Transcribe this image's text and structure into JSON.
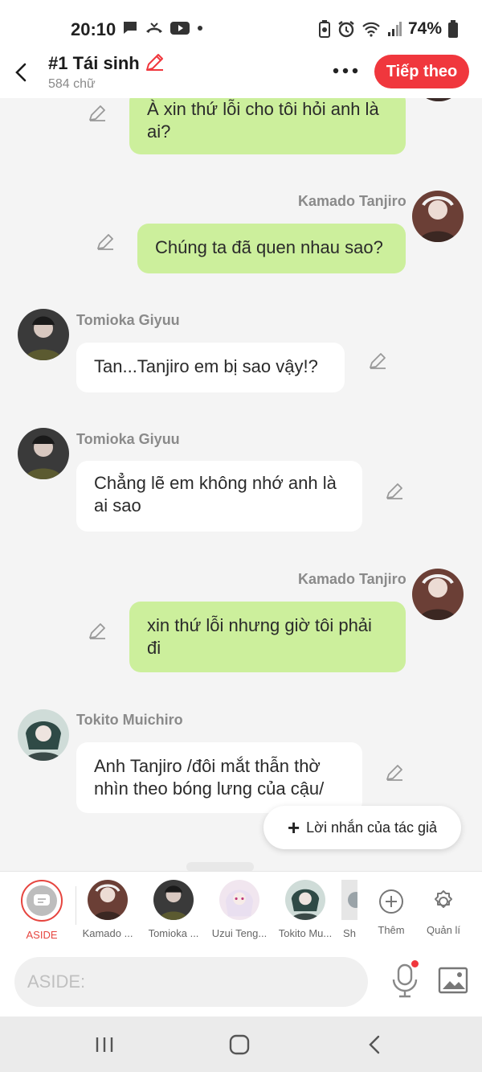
{
  "status_bar": {
    "time": "20:10",
    "battery_text": "74%"
  },
  "header": {
    "title": "#1 Tái sinh",
    "subtitle": "584 chữ",
    "next_label": "Tiếp theo"
  },
  "messages": [
    {
      "side": "right",
      "sender": "",
      "text": "À xin thứ lỗi cho tôi hỏi anh là ai?"
    },
    {
      "side": "right",
      "sender": "Kamado Tanjiro",
      "text": "Chúng ta đã quen nhau sao?"
    },
    {
      "side": "left",
      "sender": "Tomioka Giyuu",
      "text": "Tan...Tanjiro em bị sao vậy!?"
    },
    {
      "side": "left",
      "sender": "Tomioka Giyuu",
      "text": "Chẳng lẽ em không nhớ anh là ai sao"
    },
    {
      "side": "right",
      "sender": "Kamado Tanjiro",
      "text": "xin thứ lỗi nhưng giờ tôi phải đi"
    },
    {
      "side": "left",
      "sender": "Tokito Muichiro",
      "text": "Anh Tanjiro /đôi mắt thẫn thờ nhìn theo bóng lưng của cậu/"
    }
  ],
  "author_note_label": "Lời nhắn của tác giả",
  "characters": [
    {
      "label": "ASIDE"
    },
    {
      "label": "Kamado ..."
    },
    {
      "label": "Tomioka ..."
    },
    {
      "label": "Uzui Teng..."
    },
    {
      "label": "Tokito Mu..."
    },
    {
      "label": "Sh"
    },
    {
      "label": "Thêm"
    },
    {
      "label": "Quản lí"
    }
  ],
  "input": {
    "placeholder": "ASIDE:"
  },
  "colors": {
    "accent": "#f0373d",
    "bubble_right": "#ccef9c",
    "bubble_left": "#ffffff"
  }
}
